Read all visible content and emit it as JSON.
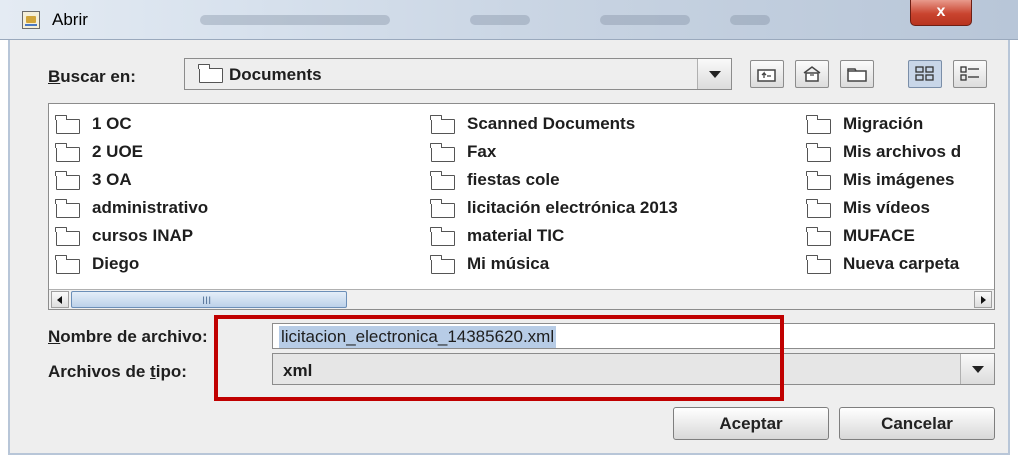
{
  "window": {
    "title": "Abrir",
    "close_glyph": "x"
  },
  "look_in": {
    "label_underlined": "B",
    "label_rest": "uscar en:",
    "value": "Documents"
  },
  "toolbar": {
    "buttons": [
      "up-folder-icon",
      "home-icon",
      "new-folder-icon",
      "list-view-icon",
      "details-view-icon"
    ]
  },
  "files": {
    "columns": [
      [
        "1 OC",
        "2 UOE",
        "3 OA",
        "administrativo",
        "cursos INAP",
        "Diego"
      ],
      [
        "Scanned Documents",
        "Fax",
        "fiestas cole",
        "licitación electrónica 2013",
        "material TIC",
        "Mi música"
      ],
      [
        "Migración",
        "Mis archivos d",
        "Mis imágenes",
        "Mis vídeos",
        "MUFACE",
        "Nueva carpeta"
      ]
    ],
    "scroll_grip": "III"
  },
  "filename": {
    "label_underlined": "N",
    "label_rest": "ombre de archivo:",
    "value": "licitacion_electronica_14385620.xml"
  },
  "filetype": {
    "label_pre": "Archivos de ",
    "label_underlined": "t",
    "label_rest": "ipo:",
    "value": "xml"
  },
  "buttons": {
    "accept": "Aceptar",
    "cancel": "Cancelar"
  },
  "colors": {
    "highlight": "#c00000",
    "selection": "#b7cce6"
  }
}
